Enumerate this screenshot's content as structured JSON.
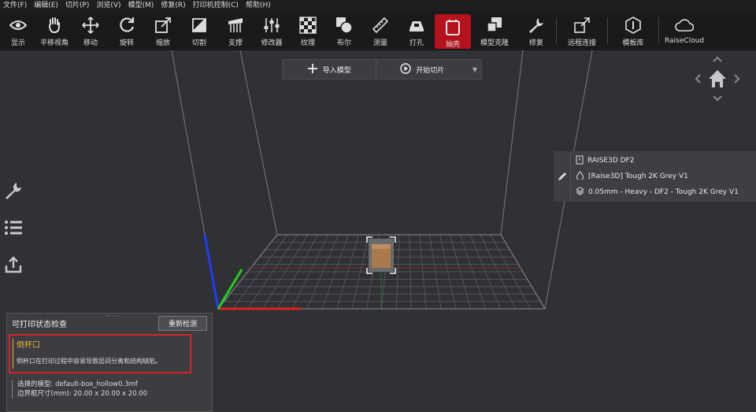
{
  "menu": [
    "文件(F)",
    "编辑(E)",
    "切片(P)",
    "浏览(V)",
    "模型(M)",
    "修复(R)",
    "打印机控制(C)",
    "帮助(H)"
  ],
  "toolbar": {
    "display": "显示",
    "pan": "平移视角",
    "move": "移动",
    "rotate": "旋转",
    "scale": "缩放",
    "cut": "切割",
    "support": "支撑",
    "modifier": "修改器",
    "texture": "纹理",
    "boolean": "布尔",
    "measure": "测量",
    "drill": "打孔",
    "hollow": "抽壳",
    "clone": "模型克隆",
    "repair": "修复",
    "remote": "远程连接",
    "library": "模板库",
    "cloud": "RaiseCloud"
  },
  "topbar": {
    "import": "导入模型",
    "slice": "开始切片"
  },
  "printer": {
    "name": "RAISE3D DF2",
    "material": "[Raise3D] Tough 2K Grey V1",
    "profile": "0.05mm - Heavy - DF2 - Tough 2K Grey V1"
  },
  "check": {
    "title": "可打印状态检查",
    "recheck": "重新检测",
    "issue_title": "倒杯口",
    "issue_desc": "倒杯口在打印过程中容易导致层间分离和结构缺陷。",
    "model_line": "选择的模型: default-box_hollow0.3mf",
    "bbox_line": "边界框尺寸(mm): 20.00 x 20.00 x 20.00"
  },
  "colors": {
    "accent": "#b4121c",
    "warning": "#e3b23c",
    "highlight": "#d2262a"
  }
}
